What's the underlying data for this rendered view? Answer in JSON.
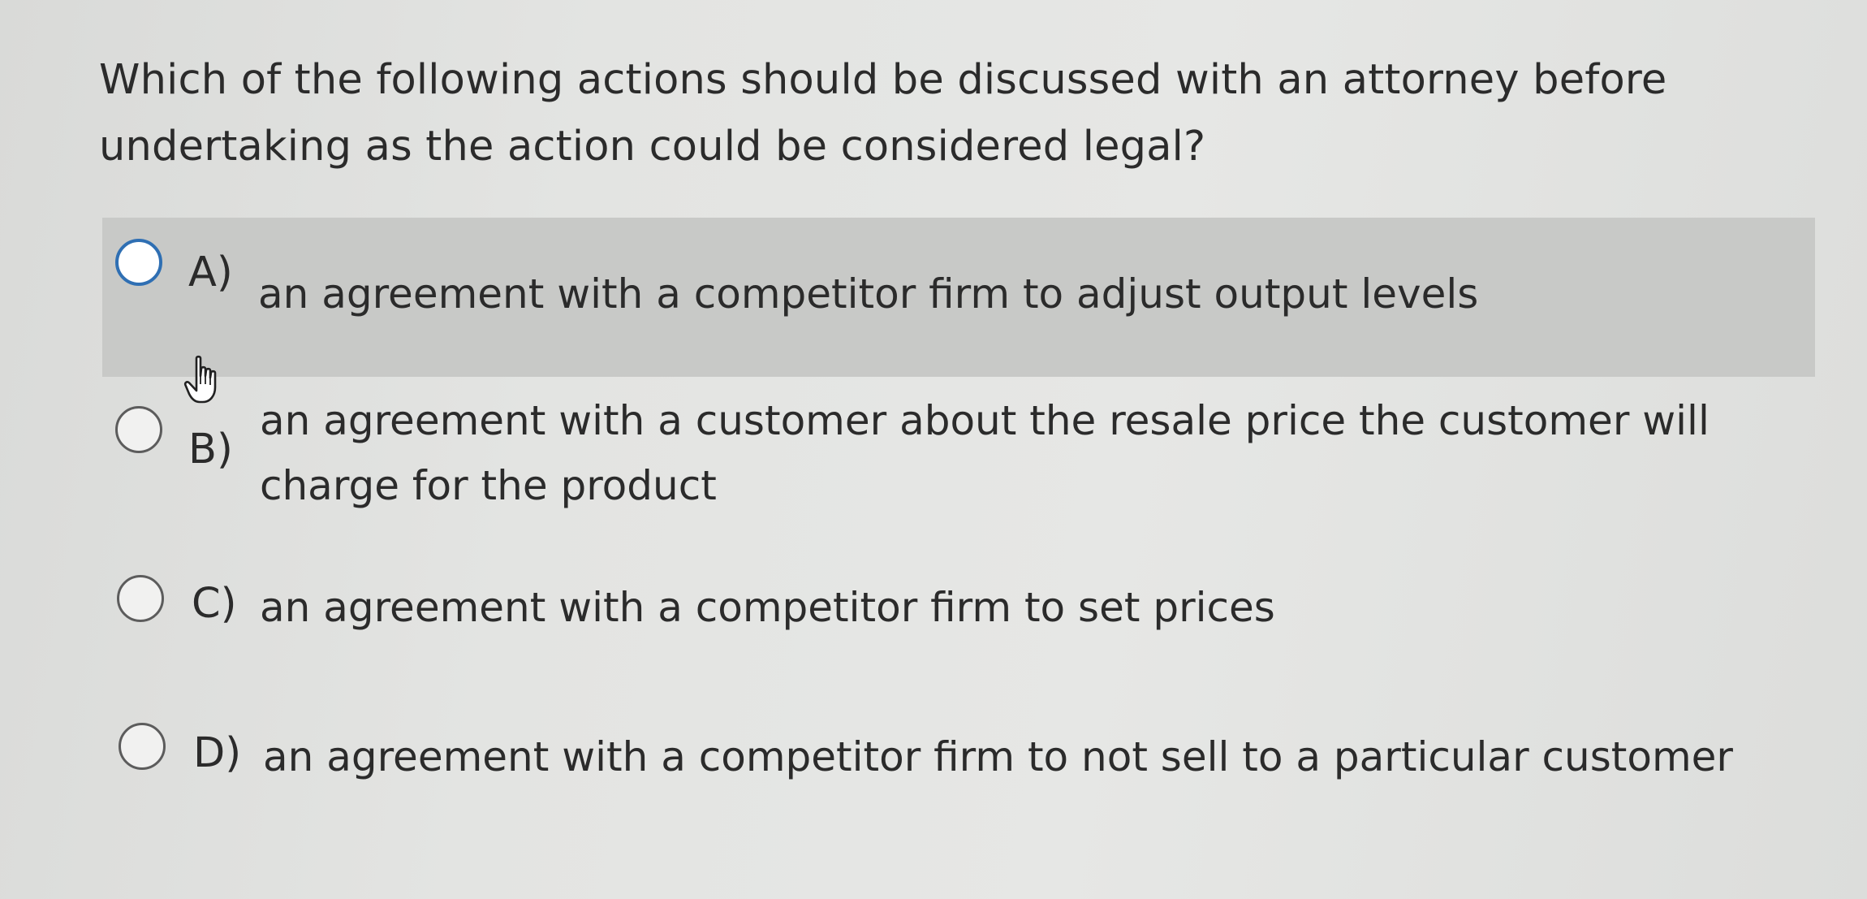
{
  "question": {
    "text": "Which of the following actions should be discussed with an attorney before undertaking as the action could be considered legal?"
  },
  "options": [
    {
      "letter": "A)",
      "text": "an agreement with a competitor firm to adjust output levels",
      "selected": false,
      "hovered": true
    },
    {
      "letter": "B)",
      "text": "an agreement with a customer about the resale price the customer will charge for the product",
      "selected": false,
      "hovered": false
    },
    {
      "letter": "C)",
      "text": "an agreement with a competitor firm to set prices",
      "selected": false,
      "hovered": false
    },
    {
      "letter": "D)",
      "text": "an agreement with a competitor firm to not sell to a particular customer",
      "selected": false,
      "hovered": false
    }
  ],
  "cursor": {
    "icon": "hand-pointer-icon"
  },
  "colors": {
    "hover_bg": "#c8c9c7",
    "radio_focus": "#2f6fb3",
    "text": "#2b2b2b"
  }
}
